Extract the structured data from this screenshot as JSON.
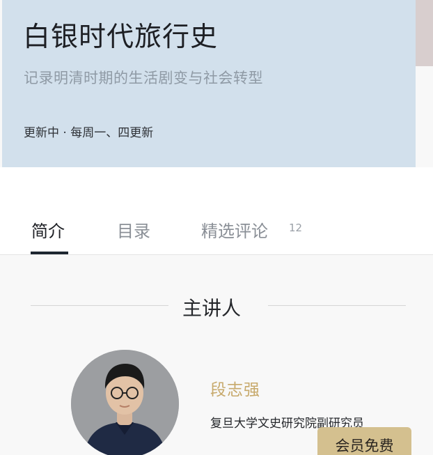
{
  "course": {
    "title": "白银时代旅行史",
    "subtitle": "记录明清时期的生活剧变与社会转型",
    "status": "更新中 · 每周一、四更新"
  },
  "tabs": [
    {
      "label": "简介",
      "active": true
    },
    {
      "label": "目录",
      "active": false
    },
    {
      "label": "精选评论",
      "active": false,
      "count": "12"
    }
  ],
  "section": {
    "title": "主讲人"
  },
  "speaker": {
    "name": "段志强",
    "title": "复旦大学文史研究院副研究员"
  },
  "cta": {
    "label": "会员免费"
  },
  "colors": {
    "hero_bg": "#d2e0ec",
    "accent_gold": "#c7a96b",
    "button_bg": "#d4c08f",
    "tab_indicator": "#1d2630"
  }
}
